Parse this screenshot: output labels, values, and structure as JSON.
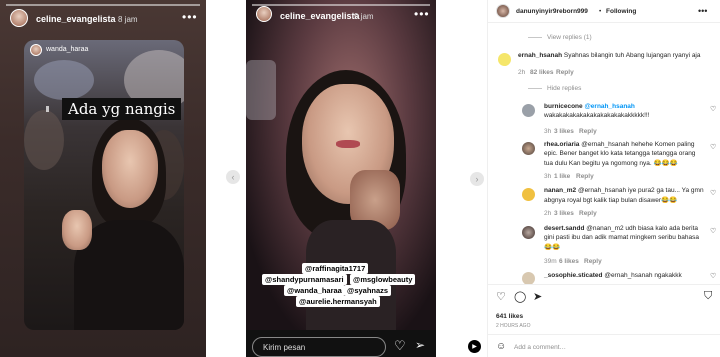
{
  "story_left": {
    "username": "celine_evangelista",
    "time": "8 jam",
    "menu": "•••",
    "inner_username": "wanda_haraa",
    "caption": "Ada yg nangis"
  },
  "story_right": {
    "username": "celine_evangelista",
    "time": "9 jam",
    "menu": "•••",
    "tags": [
      "@raffinagita1717",
      "@shandypurnamasari",
      "@msglowbeauty",
      "@wanda_haraa",
      "@syahnazs",
      "@aurelie.hermansyah"
    ],
    "reply_placeholder": "Kirim pesan"
  },
  "post": {
    "author": "danunyinyir9reborn999",
    "separator": "•",
    "follow": "Following",
    "menu": "•••",
    "view_replies": "View replies (1)",
    "hide_replies": "Hide replies",
    "likes": "641 likes",
    "time_ago": "2 HOURS AGO",
    "add_comment": "Add a comment…",
    "comments": [
      {
        "user": "ernah_hsanah",
        "text": "Syahnas bilangin tuh Abang lujangan ryanyi aja",
        "meta": "2h",
        "likes": "82 likes",
        "reply": "Reply"
      },
      {
        "user": "burnicecone",
        "text": "@ernah_hsanah",
        "line2": "wakakakakakakakakakakakakkkkk!!!",
        "meta": "3h",
        "likes": "3 likes",
        "reply": "Reply"
      },
      {
        "user": "rhea.oriaria",
        "text": "@ernah_hsanah hehehe Komen paling",
        "line2": "epic. Bener banget klo kata tetangga tetangga orang",
        "line3": "tua dulu Kan begitu ya ngomong nya. 😂😂😂",
        "meta": "3h",
        "likes": "1 like",
        "reply": "Reply"
      },
      {
        "user": "nanan_m2",
        "text": "@ernah_hsanah iye pura2 ga tau... Ya gmn",
        "line2": "abgnya royal bgt kalik tiap bulan disawer😂😂",
        "meta": "2h",
        "likes": "3 likes",
        "reply": "Reply"
      },
      {
        "user": "desert.sandd",
        "text": "@nanan_m2 udh biasa kalo ada berita",
        "line2": "gini pasti ibu dan adik mamat mingkem seribu bahasa",
        "line3": "😂😂",
        "meta": "39m",
        "likes": "6 likes",
        "reply": "Reply"
      },
      {
        "user": "_sosophie.sticated",
        "text": "@ernah_hsanah ngakakkk"
      }
    ]
  },
  "colors": {
    "accent": "#0095f6",
    "text": "#262626",
    "muted": "#8e8e8e"
  }
}
